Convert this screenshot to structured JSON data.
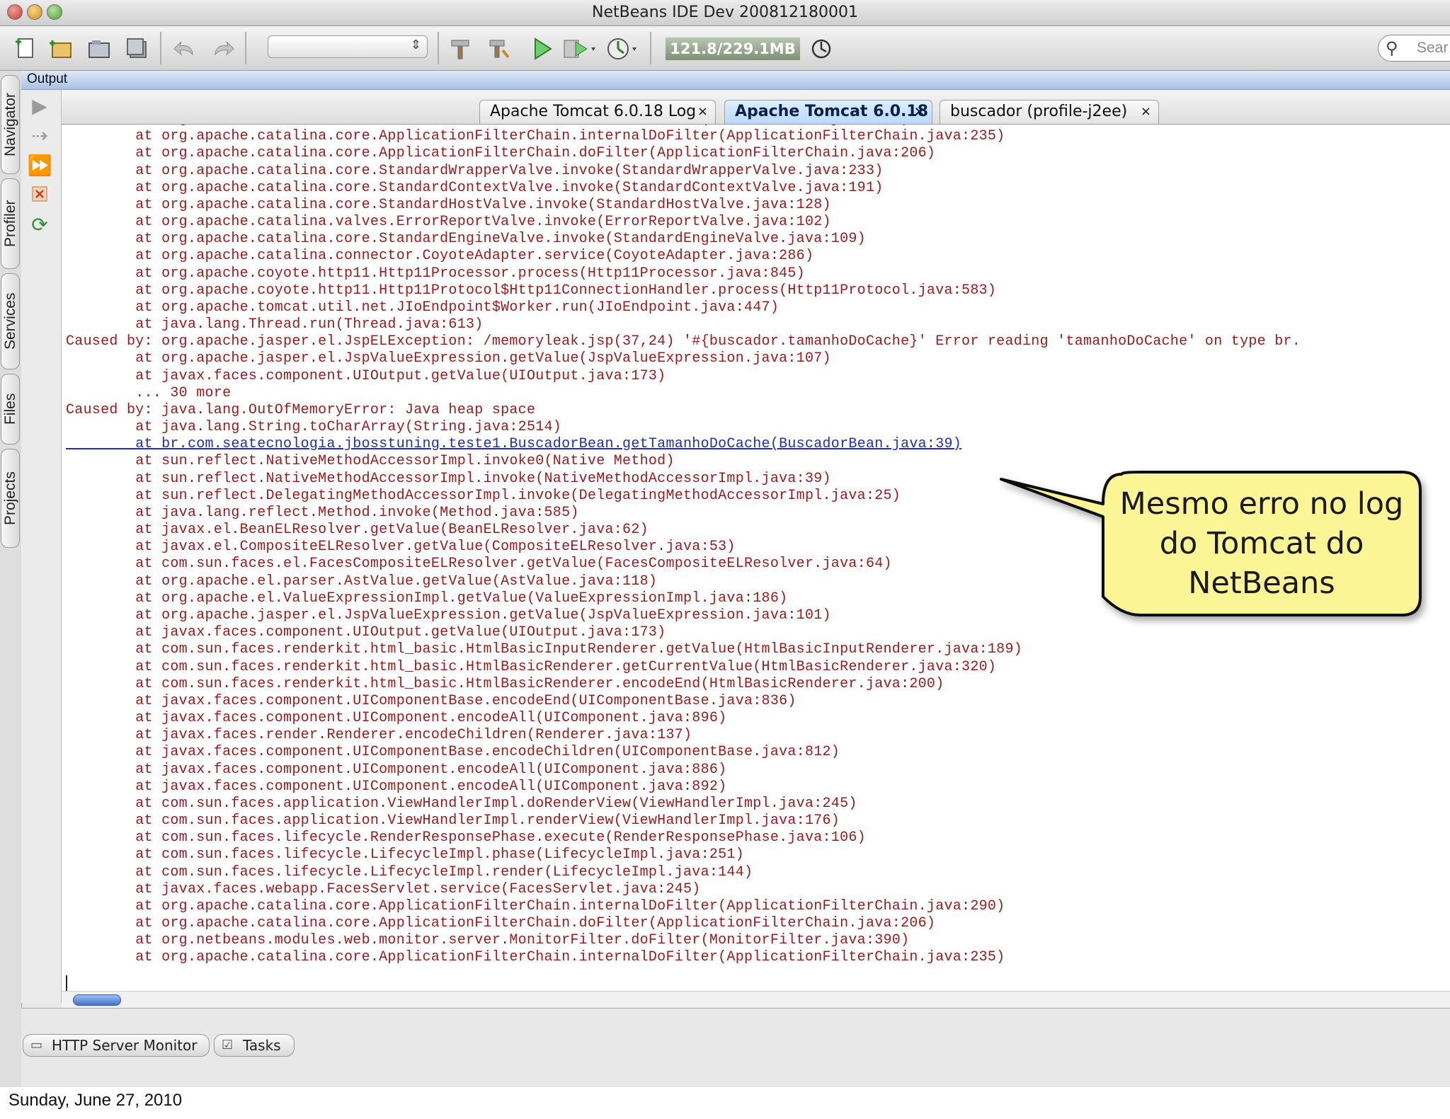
{
  "window": {
    "title": "NetBeans IDE Dev 200812180001"
  },
  "toolbar": {
    "memory": "121.8/229.1MB",
    "search_placeholder": "Sear"
  },
  "sidebar": {
    "tabs": [
      "Navigator",
      "Profiler",
      "Services",
      "Files",
      "Projects"
    ]
  },
  "output": {
    "title": "Output",
    "tabs": [
      {
        "label": "Apache Tomcat 6.0.18 Log",
        "active": false
      },
      {
        "label": "Apache Tomcat 6.0.18",
        "active": true
      },
      {
        "label": "buscador (profile-j2ee)",
        "active": false
      }
    ],
    "close_glyph": "×",
    "lines": [
      "        at org.netbeans.modules.web.monitor.server.MonitorFilter.doFilter(MonitorFilter.java:390)",
      "        at org.apache.catalina.core.ApplicationFilterChain.internalDoFilter(ApplicationFilterChain.java:235)",
      "        at org.apache.catalina.core.ApplicationFilterChain.doFilter(ApplicationFilterChain.java:206)",
      "        at org.apache.catalina.core.StandardWrapperValve.invoke(StandardWrapperValve.java:233)",
      "        at org.apache.catalina.core.StandardContextValve.invoke(StandardContextValve.java:191)",
      "        at org.apache.catalina.core.StandardHostValve.invoke(StandardHostValve.java:128)",
      "        at org.apache.catalina.valves.ErrorReportValve.invoke(ErrorReportValve.java:102)",
      "        at org.apache.catalina.core.StandardEngineValve.invoke(StandardEngineValve.java:109)",
      "        at org.apache.catalina.connector.CoyoteAdapter.service(CoyoteAdapter.java:286)",
      "        at org.apache.coyote.http11.Http11Processor.process(Http11Processor.java:845)",
      "        at org.apache.coyote.http11.Http11Protocol$Http11ConnectionHandler.process(Http11Protocol.java:583)",
      "        at org.apache.tomcat.util.net.JIoEndpoint$Worker.run(JIoEndpoint.java:447)",
      "        at java.lang.Thread.run(Thread.java:613)",
      "Caused by: org.apache.jasper.el.JspELException: /memoryleak.jsp(37,24) '#{buscador.tamanhoDoCache}' Error reading 'tamanhoDoCache' on type br.",
      "        at org.apache.jasper.el.JspValueExpression.getValue(JspValueExpression.java:107)",
      "        at javax.faces.component.UIOutput.getValue(UIOutput.java:173)",
      "        ... 30 more",
      "Caused by: java.lang.OutOfMemoryError: Java heap space",
      "        at java.lang.String.toCharArray(String.java:2514)",
      "        at br.com.seatecnologia.jbosstuning.teste1.BuscadorBean.getTamanhoDoCache(BuscadorBean.java:39)",
      "        at sun.reflect.NativeMethodAccessorImpl.invoke0(Native Method)",
      "        at sun.reflect.NativeMethodAccessorImpl.invoke(NativeMethodAccessorImpl.java:39)",
      "        at sun.reflect.DelegatingMethodAccessorImpl.invoke(DelegatingMethodAccessorImpl.java:25)",
      "        at java.lang.reflect.Method.invoke(Method.java:585)",
      "        at javax.el.BeanELResolver.getValue(BeanELResolver.java:62)",
      "        at javax.el.CompositeELResolver.getValue(CompositeELResolver.java:53)",
      "        at com.sun.faces.el.FacesCompositeELResolver.getValue(FacesCompositeELResolver.java:64)",
      "        at org.apache.el.parser.AstValue.getValue(AstValue.java:118)",
      "        at org.apache.el.ValueExpressionImpl.getValue(ValueExpressionImpl.java:186)",
      "        at org.apache.jasper.el.JspValueExpression.getValue(JspValueExpression.java:101)",
      "        at javax.faces.component.UIOutput.getValue(UIOutput.java:173)",
      "        at com.sun.faces.renderkit.html_basic.HtmlBasicInputRenderer.getValue(HtmlBasicInputRenderer.java:189)",
      "        at com.sun.faces.renderkit.html_basic.HtmlBasicRenderer.getCurrentValue(HtmlBasicRenderer.java:320)",
      "        at com.sun.faces.renderkit.html_basic.HtmlBasicRenderer.encodeEnd(HtmlBasicRenderer.java:200)",
      "        at javax.faces.component.UIComponentBase.encodeEnd(UIComponentBase.java:836)",
      "        at javax.faces.component.UIComponent.encodeAll(UIComponent.java:896)",
      "        at javax.faces.render.Renderer.encodeChildren(Renderer.java:137)",
      "        at javax.faces.component.UIComponentBase.encodeChildren(UIComponentBase.java:812)",
      "        at javax.faces.component.UIComponent.encodeAll(UIComponent.java:886)",
      "        at javax.faces.component.UIComponent.encodeAll(UIComponent.java:892)",
      "        at com.sun.faces.application.ViewHandlerImpl.doRenderView(ViewHandlerImpl.java:245)",
      "        at com.sun.faces.application.ViewHandlerImpl.renderView(ViewHandlerImpl.java:176)",
      "        at com.sun.faces.lifecycle.RenderResponsePhase.execute(RenderResponsePhase.java:106)",
      "        at com.sun.faces.lifecycle.LifecycleImpl.phase(LifecycleImpl.java:251)",
      "        at com.sun.faces.lifecycle.LifecycleImpl.render(LifecycleImpl.java:144)",
      "        at javax.faces.webapp.FacesServlet.service(FacesServlet.java:245)",
      "        at org.apache.catalina.core.ApplicationFilterChain.internalDoFilter(ApplicationFilterChain.java:290)",
      "        at org.apache.catalina.core.ApplicationFilterChain.doFilter(ApplicationFilterChain.java:206)",
      "        at org.netbeans.modules.web.monitor.server.MonitorFilter.doFilter(MonitorFilter.java:390)",
      "        at org.apache.catalina.core.ApplicationFilterChain.internalDoFilter(ApplicationFilterChain.java:235)"
    ],
    "link_line_index": 19
  },
  "bottom_tabs": [
    {
      "label": "HTTP Server Monitor",
      "icon": "monitor-icon"
    },
    {
      "label": "Tasks",
      "icon": "tasks-icon"
    }
  ],
  "callout": {
    "lines": [
      "Mesmo erro no log",
      "do Tomcat do",
      "NetBeans"
    ],
    "fill": "#fbf596"
  },
  "footer": {
    "date": "Sunday, June 27, 2010"
  },
  "colors": {
    "log_text": "#9a1a1a",
    "log_link": "#1f2fb5",
    "output_header": "#a9c1e6",
    "active_tab": "#bad7fb"
  }
}
